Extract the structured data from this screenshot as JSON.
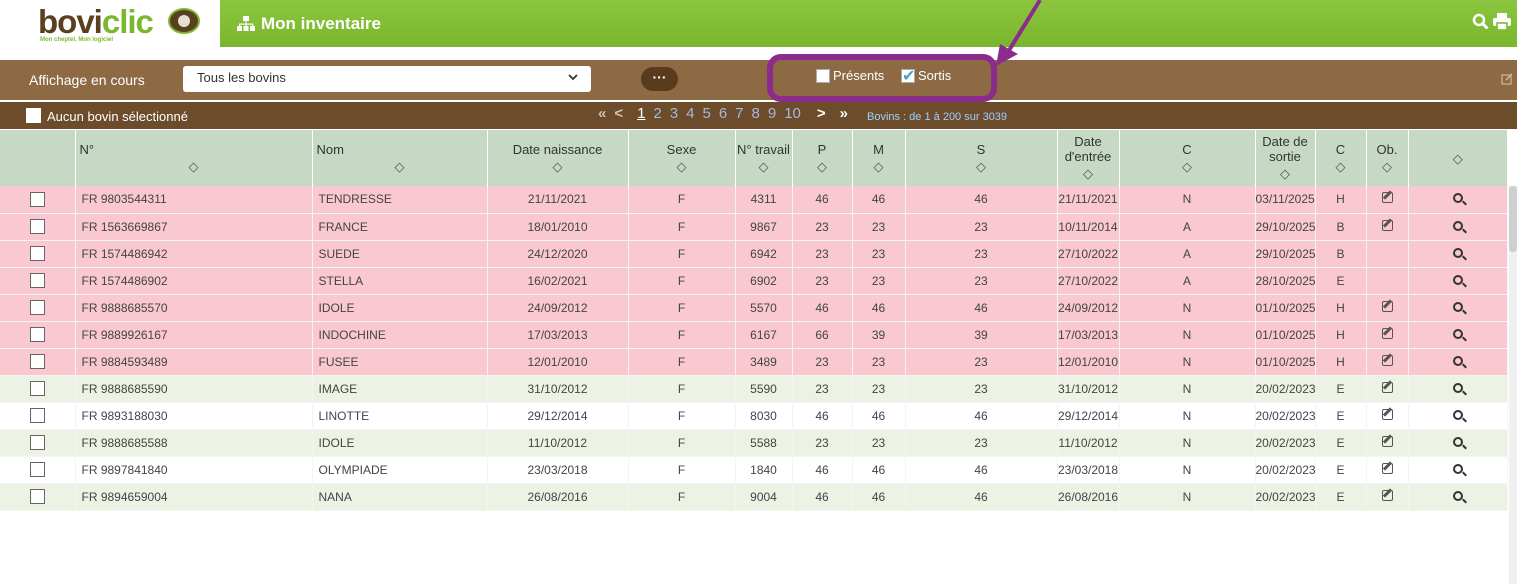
{
  "app": {
    "logo_part1": "bovi",
    "logo_part2": "clic",
    "tagline": "Mon cheptel. Mon logiciel",
    "title": "Mon inventaire",
    "colors": {
      "green": "#8cc63f",
      "brown": "#8e6a44",
      "dark_brown": "#6d4c2c",
      "pink_row": "#f9c8d0",
      "green_row": "#ecf3e4",
      "annotation": "#8b2c8d"
    }
  },
  "toolbar": {
    "search_icon": "search-icon",
    "print_icon": "print-icon"
  },
  "filter": {
    "label": "Affichage en cours",
    "selected": "Tous les bovins",
    "more_label": "···",
    "presents_label": "Présents",
    "presents_checked": false,
    "sortis_label": "Sortis",
    "sortis_checked": true
  },
  "selection": {
    "label": "Aucun bovin sélectionné"
  },
  "pagination": {
    "first": "«",
    "prev": "<",
    "pages": [
      "1",
      "2",
      "3",
      "4",
      "5",
      "6",
      "7",
      "8",
      "9",
      "10"
    ],
    "current": "1",
    "next": ">",
    "last": "»",
    "range_text": "Bovins : de 1 à 200 sur 3039"
  },
  "table": {
    "headers": [
      "N°",
      "Nom",
      "Date naissance",
      "Sexe",
      "N° travail",
      "P",
      "M",
      "S",
      "Date d'entrée",
      "C",
      "Date de sortie",
      "C",
      "Ob.",
      ""
    ],
    "sort_glyph": "◇",
    "rows": [
      {
        "style": "pink",
        "num": "FR 9803544311",
        "nom": "TENDRESSE",
        "naissance": "21/11/2021",
        "sexe": "F",
        "travail": "4311",
        "p": "46",
        "m": "46",
        "s": "46",
        "entree": "21/11/2021",
        "c1": "N",
        "sortie": "03/11/2025",
        "c2": "H",
        "ob": true
      },
      {
        "style": "pink",
        "num": "FR 1563669867",
        "nom": "FRANCE",
        "naissance": "18/01/2010",
        "sexe": "F",
        "travail": "9867",
        "p": "23",
        "m": "23",
        "s": "23",
        "entree": "10/11/2014",
        "c1": "A",
        "sortie": "29/10/2025",
        "c2": "B",
        "ob": true
      },
      {
        "style": "pink",
        "num": "FR 1574486942",
        "nom": "SUEDE",
        "naissance": "24/12/2020",
        "sexe": "F",
        "travail": "6942",
        "p": "23",
        "m": "23",
        "s": "23",
        "entree": "27/10/2022",
        "c1": "A",
        "sortie": "29/10/2025",
        "c2": "B",
        "ob": false
      },
      {
        "style": "pink",
        "num": "FR 1574486902",
        "nom": "STELLA",
        "naissance": "16/02/2021",
        "sexe": "F",
        "travail": "6902",
        "p": "23",
        "m": "23",
        "s": "23",
        "entree": "27/10/2022",
        "c1": "A",
        "sortie": "28/10/2025",
        "c2": "E",
        "ob": false
      },
      {
        "style": "pink",
        "num": "FR 9888685570",
        "nom": "IDOLE",
        "naissance": "24/09/2012",
        "sexe": "F",
        "travail": "5570",
        "p": "46",
        "m": "46",
        "s": "46",
        "entree": "24/09/2012",
        "c1": "N",
        "sortie": "01/10/2025",
        "c2": "H",
        "ob": true
      },
      {
        "style": "pink",
        "num": "FR 9889926167",
        "nom": "INDOCHINE",
        "naissance": "17/03/2013",
        "sexe": "F",
        "travail": "6167",
        "p": "66",
        "m": "39",
        "s": "39",
        "entree": "17/03/2013",
        "c1": "N",
        "sortie": "01/10/2025",
        "c2": "H",
        "ob": true
      },
      {
        "style": "pink",
        "num": "FR 9884593489",
        "nom": "FUSEE",
        "naissance": "12/01/2010",
        "sexe": "F",
        "travail": "3489",
        "p": "23",
        "m": "23",
        "s": "23",
        "entree": "12/01/2010",
        "c1": "N",
        "sortie": "01/10/2025",
        "c2": "H",
        "ob": true
      },
      {
        "style": "green",
        "num": "FR 9888685590",
        "nom": "IMAGE",
        "naissance": "31/10/2012",
        "sexe": "F",
        "travail": "5590",
        "p": "23",
        "m": "23",
        "s": "23",
        "entree": "31/10/2012",
        "c1": "N",
        "sortie": "20/02/2023",
        "c2": "E",
        "ob": true
      },
      {
        "style": "white",
        "num": "FR 9893188030",
        "nom": "LINOTTE",
        "naissance": "29/12/2014",
        "sexe": "F",
        "travail": "8030",
        "p": "46",
        "m": "46",
        "s": "46",
        "entree": "29/12/2014",
        "c1": "N",
        "sortie": "20/02/2023",
        "c2": "E",
        "ob": true
      },
      {
        "style": "green",
        "num": "FR 9888685588",
        "nom": "IDOLE",
        "naissance": "11/10/2012",
        "sexe": "F",
        "travail": "5588",
        "p": "23",
        "m": "23",
        "s": "23",
        "entree": "11/10/2012",
        "c1": "N",
        "sortie": "20/02/2023",
        "c2": "E",
        "ob": true
      },
      {
        "style": "white",
        "num": "FR 9897841840",
        "nom": "OLYMPIADE",
        "naissance": "23/03/2018",
        "sexe": "F",
        "travail": "1840",
        "p": "46",
        "m": "46",
        "s": "46",
        "entree": "23/03/2018",
        "c1": "N",
        "sortie": "20/02/2023",
        "c2": "E",
        "ob": true
      },
      {
        "style": "green",
        "num": "FR 9894659004",
        "nom": "NANA",
        "naissance": "26/08/2016",
        "sexe": "F",
        "travail": "9004",
        "p": "46",
        "m": "46",
        "s": "46",
        "entree": "26/08/2016",
        "c1": "N",
        "sortie": "20/02/2023",
        "c2": "E",
        "ob": true
      }
    ]
  }
}
